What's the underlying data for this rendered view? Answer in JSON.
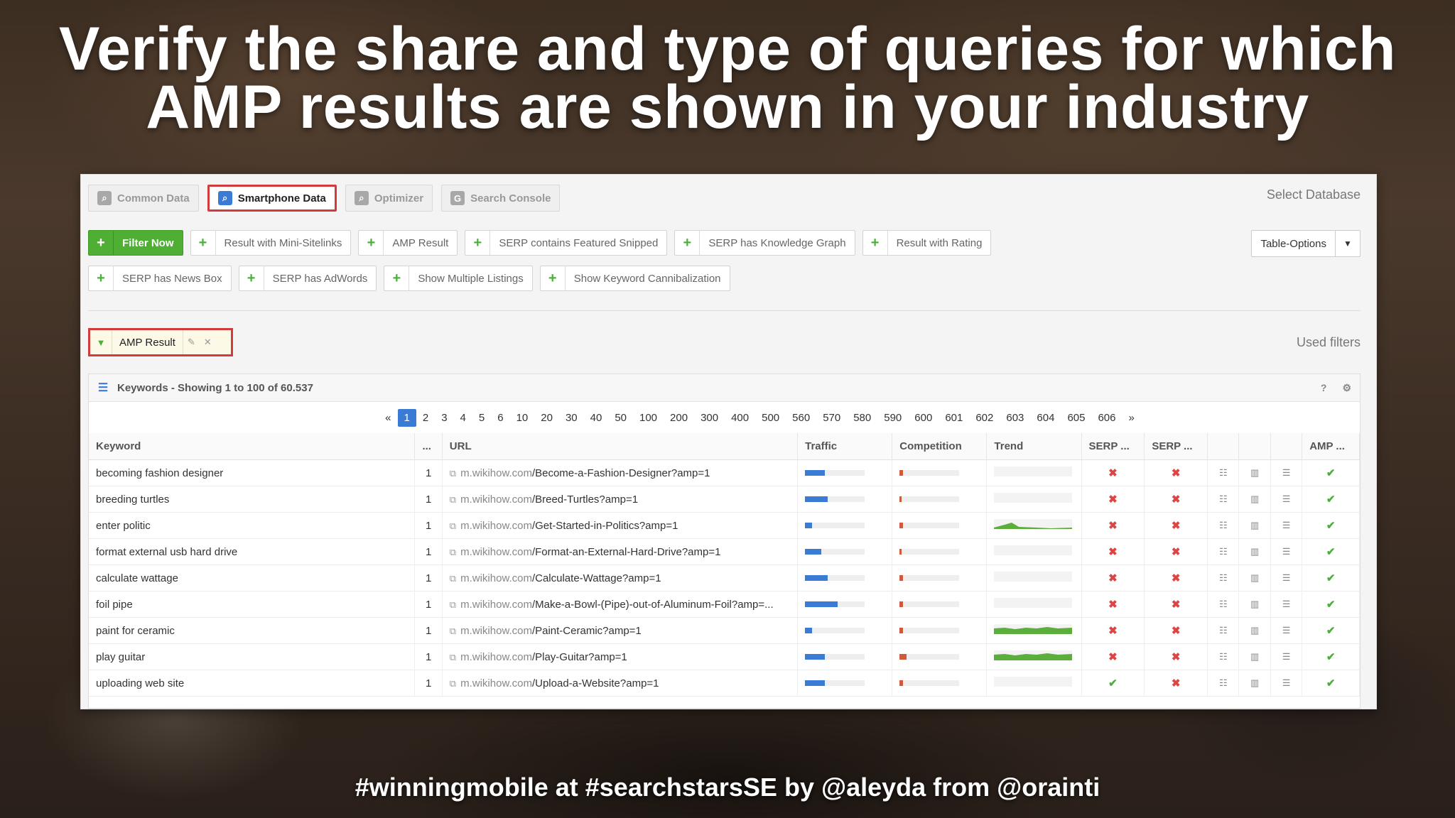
{
  "slide": {
    "headline_line1": "Verify the share and type of queries for which",
    "headline_line2": "AMP results are shown in your industry",
    "footer": "#winningmobile at #searchstarsSE by @aleyda from @orainti"
  },
  "tabs": [
    {
      "label": "Common Data",
      "icon": "search-icon",
      "active": false
    },
    {
      "label": "Smartphone Data",
      "icon": "search-icon",
      "active": true
    },
    {
      "label": "Optimizer",
      "icon": "search-icon",
      "active": false
    },
    {
      "label": "Search Console",
      "icon": "google-icon",
      "active": false
    }
  ],
  "select_database": "Select Database",
  "filters_row1": [
    "Filter Now",
    "Result with Mini-Sitelinks",
    "AMP Result",
    "SERP contains Featured Snipped",
    "SERP has Knowledge Graph",
    "Result with Rating"
  ],
  "filters_row2": [
    "SERP has News Box",
    "SERP has AdWords",
    "Show Multiple Listings",
    "Show Keyword Cannibalization"
  ],
  "table_options": "Table-Options",
  "active_filter": "AMP Result",
  "used_filters": "Used filters",
  "keywords_header": "Keywords - Showing 1 to 100 of 60.537",
  "help": "?",
  "pagination": [
    "«",
    "1",
    "2",
    "3",
    "4",
    "5",
    "6",
    "10",
    "20",
    "30",
    "40",
    "50",
    "100",
    "200",
    "300",
    "400",
    "500",
    "560",
    "570",
    "580",
    "590",
    "600",
    "601",
    "602",
    "603",
    "604",
    "605",
    "606",
    "»"
  ],
  "current_page": "1",
  "columns": [
    "Keyword",
    "...",
    "URL",
    "Traffic",
    "Competition",
    "Trend",
    "SERP ...",
    "SERP ...",
    "",
    "",
    "",
    "AMP ..."
  ],
  "colors": {
    "accent": "#3a7bd5",
    "green": "#4fae34",
    "red_highlight": "#d23b3b"
  },
  "rows": [
    {
      "keyword": "becoming fashion designer",
      "pos": "1",
      "domain": "m.wikihow.com",
      "path": "/Become-a-Fashion-Designer?amp=1",
      "traffic": 0.33,
      "competition": 0.06,
      "trend": "flat",
      "serp1": "x",
      "serp2": "x",
      "amp": "check"
    },
    {
      "keyword": "breeding turtles",
      "pos": "1",
      "domain": "m.wikihow.com",
      "path": "/Breed-Turtles?amp=1",
      "traffic": 0.38,
      "competition": 0.03,
      "trend": "flat",
      "serp1": "x",
      "serp2": "x",
      "amp": "check"
    },
    {
      "keyword": "enter politic",
      "pos": "1",
      "domain": "m.wikihow.com",
      "path": "/Get-Started-in-Politics?amp=1",
      "traffic": 0.12,
      "competition": 0.06,
      "trend": "low",
      "serp1": "x",
      "serp2": "x",
      "amp": "check"
    },
    {
      "keyword": "format external usb hard drive",
      "pos": "1",
      "domain": "m.wikihow.com",
      "path": "/Format-an-External-Hard-Drive?amp=1",
      "traffic": 0.27,
      "competition": 0.03,
      "trend": "flat",
      "serp1": "x",
      "serp2": "x",
      "amp": "check"
    },
    {
      "keyword": "calculate wattage",
      "pos": "1",
      "domain": "m.wikihow.com",
      "path": "/Calculate-Wattage?amp=1",
      "traffic": 0.38,
      "competition": 0.06,
      "trend": "flat",
      "serp1": "x",
      "serp2": "x",
      "amp": "check"
    },
    {
      "keyword": "foil pipe",
      "pos": "1",
      "domain": "m.wikihow.com",
      "path": "/Make-a-Bowl-(Pipe)-out-of-Aluminum-Foil?amp=...",
      "traffic": 0.55,
      "competition": 0.06,
      "trend": "flat",
      "serp1": "x",
      "serp2": "x",
      "amp": "check"
    },
    {
      "keyword": "paint for ceramic",
      "pos": "1",
      "domain": "m.wikihow.com",
      "path": "/Paint-Ceramic?amp=1",
      "traffic": 0.12,
      "competition": 0.06,
      "trend": "high",
      "serp1": "x",
      "serp2": "x",
      "amp": "check"
    },
    {
      "keyword": "play guitar",
      "pos": "1",
      "domain": "m.wikihow.com",
      "path": "/Play-Guitar?amp=1",
      "traffic": 0.33,
      "competition": 0.12,
      "trend": "high",
      "serp1": "x",
      "serp2": "x",
      "amp": "check"
    },
    {
      "keyword": "uploading web site",
      "pos": "1",
      "domain": "m.wikihow.com",
      "path": "/Upload-a-Website?amp=1",
      "traffic": 0.33,
      "competition": 0.06,
      "trend": "flat",
      "serp1": "check",
      "serp2": "x",
      "amp": "check"
    }
  ]
}
